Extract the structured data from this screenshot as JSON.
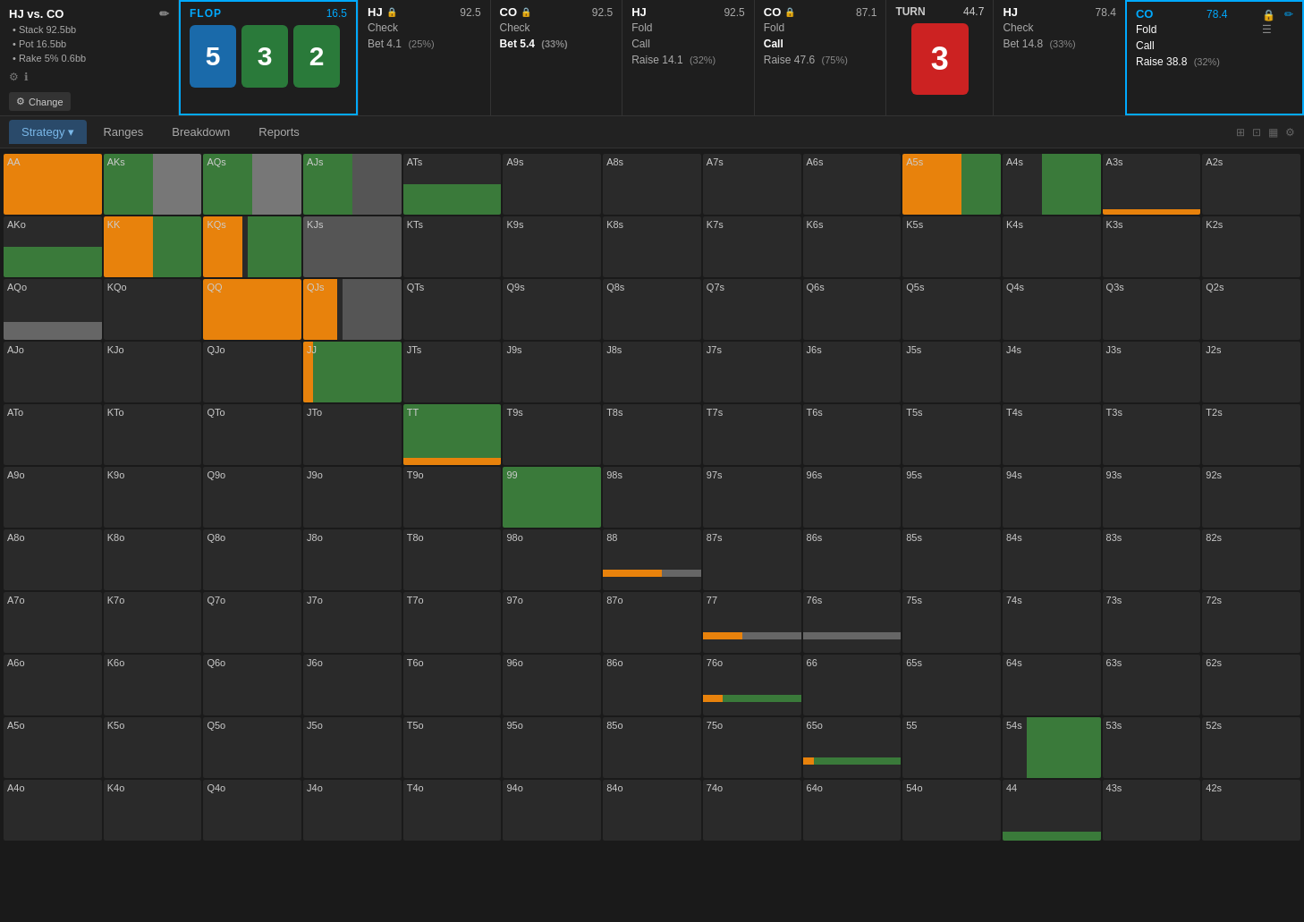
{
  "header": {
    "game_title": "HJ vs. CO",
    "stack": "Stack 92.5bb",
    "pot": "Pot 16.5bb",
    "rake": "Rake 5% 0.6bb",
    "change_btn": "Change",
    "flop": {
      "label": "FLOP",
      "pot": "16.5",
      "cards": [
        "5",
        "3",
        "2"
      ],
      "card_colors": [
        "blue",
        "green",
        "green"
      ]
    },
    "players": [
      {
        "name": "HJ",
        "stack": "92.5",
        "locked": true,
        "actions": [
          {
            "label": "Check",
            "pct": null,
            "active": false
          },
          {
            "label": "Bet 4.1",
            "pct": "(25%)",
            "active": false
          }
        ]
      },
      {
        "name": "CO",
        "stack": "92.5",
        "locked": true,
        "actions": [
          {
            "label": "Check",
            "pct": null,
            "active": false
          },
          {
            "label": "Bet 5.4",
            "pct": "(33%)",
            "active": true
          }
        ]
      },
      {
        "name": "HJ",
        "stack": "92.5",
        "locked": false,
        "actions": [
          {
            "label": "Fold",
            "pct": null,
            "active": false
          },
          {
            "label": "Call",
            "pct": null,
            "active": false
          },
          {
            "label": "Raise 14.1",
            "pct": "(32%)",
            "active": false
          }
        ]
      },
      {
        "name": "CO",
        "stack": "87.1",
        "locked": true,
        "actions": [
          {
            "label": "Fold",
            "pct": null,
            "active": false
          },
          {
            "label": "Call",
            "pct": null,
            "active": true
          },
          {
            "label": "Raise 47.6",
            "pct": "(75%)",
            "active": false
          }
        ]
      }
    ],
    "turn": {
      "label": "TURN",
      "pot": "44.7",
      "card": "3",
      "color": "red"
    },
    "players2": [
      {
        "name": "HJ",
        "stack": "78.4",
        "locked": false,
        "actions": [
          {
            "label": "Check",
            "pct": null,
            "active": false
          },
          {
            "label": "Bet 14.8",
            "pct": "(33%)",
            "active": false
          }
        ]
      },
      {
        "name": "CO",
        "stack": "78.4",
        "locked": false,
        "active_section": true,
        "actions": [
          {
            "label": "Fold",
            "pct": null,
            "active": false
          },
          {
            "label": "Call",
            "pct": null,
            "active": false
          },
          {
            "label": "Raise 38.8",
            "pct": "(32%)",
            "active": false
          }
        ]
      }
    ]
  },
  "nav": {
    "tabs": [
      "Strategy",
      "Ranges",
      "Breakdown",
      "Reports"
    ]
  },
  "grid": {
    "cells": [
      {
        "label": "AA",
        "type": "full-orange",
        "row": 0,
        "col": 0
      },
      {
        "label": "AKs",
        "type": "half-green-gray",
        "row": 0,
        "col": 1
      },
      {
        "label": "AQs",
        "type": "half-green-gray",
        "row": 0,
        "col": 2
      },
      {
        "label": "AJs",
        "type": "half-green-dark",
        "row": 0,
        "col": 3
      },
      {
        "label": "ATs",
        "type": "half-green-dark-top",
        "row": 0,
        "col": 4
      },
      {
        "label": "A9s",
        "type": "empty",
        "row": 0,
        "col": 5
      },
      {
        "label": "A8s",
        "type": "empty",
        "row": 0,
        "col": 6
      },
      {
        "label": "A7s",
        "type": "empty",
        "row": 0,
        "col": 7
      },
      {
        "label": "A6s",
        "type": "empty",
        "row": 0,
        "col": 8
      },
      {
        "label": "A5s",
        "type": "half-orange-green",
        "row": 0,
        "col": 9
      },
      {
        "label": "A4s",
        "type": "partial-green",
        "row": 0,
        "col": 10
      },
      {
        "label": "A3s",
        "type": "orange-line",
        "row": 0,
        "col": 11
      },
      {
        "label": "A2s",
        "type": "empty",
        "row": 0,
        "col": 12
      },
      {
        "label": "AKo",
        "type": "half-green-dark",
        "row": 1,
        "col": 0
      },
      {
        "label": "KK",
        "type": "full-orange-with-green",
        "row": 1,
        "col": 1
      },
      {
        "label": "KQs",
        "type": "half-orange-green-v2",
        "row": 1,
        "col": 2
      },
      {
        "label": "KJs",
        "type": "half-gray-dark",
        "row": 1,
        "col": 3
      },
      {
        "label": "KTs",
        "type": "empty",
        "row": 1,
        "col": 4
      },
      {
        "label": "K9s",
        "type": "empty",
        "row": 1,
        "col": 5
      },
      {
        "label": "K8s",
        "type": "empty",
        "row": 1,
        "col": 6
      },
      {
        "label": "K7s",
        "type": "empty",
        "row": 1,
        "col": 7
      },
      {
        "label": "K6s",
        "type": "empty",
        "row": 1,
        "col": 8
      },
      {
        "label": "K5s",
        "type": "empty",
        "row": 1,
        "col": 9
      },
      {
        "label": "K4s",
        "type": "empty",
        "row": 1,
        "col": 10
      },
      {
        "label": "K3s",
        "type": "empty",
        "row": 1,
        "col": 11
      },
      {
        "label": "K2s",
        "type": "empty",
        "row": 1,
        "col": 12
      },
      {
        "label": "AQo",
        "type": "small-gray",
        "row": 2,
        "col": 0
      },
      {
        "label": "KQo",
        "type": "empty",
        "row": 2,
        "col": 1
      },
      {
        "label": "QQ",
        "type": "full-orange",
        "row": 2,
        "col": 2
      },
      {
        "label": "QJs",
        "type": "half-orange-small-green",
        "row": 2,
        "col": 3
      },
      {
        "label": "QTs",
        "type": "empty",
        "row": 2,
        "col": 4
      },
      {
        "label": "Q9s",
        "type": "empty",
        "row": 2,
        "col": 5
      },
      {
        "label": "Q8s",
        "type": "empty",
        "row": 2,
        "col": 6
      },
      {
        "label": "Q7s",
        "type": "empty",
        "row": 2,
        "col": 7
      },
      {
        "label": "Q6s",
        "type": "empty",
        "row": 2,
        "col": 8
      },
      {
        "label": "Q5s",
        "type": "empty",
        "row": 2,
        "col": 9
      },
      {
        "label": "Q4s",
        "type": "empty",
        "row": 2,
        "col": 10
      },
      {
        "label": "Q3s",
        "type": "empty",
        "row": 2,
        "col": 11
      },
      {
        "label": "Q2s",
        "type": "empty",
        "row": 2,
        "col": 12
      },
      {
        "label": "AJo",
        "type": "empty",
        "row": 3,
        "col": 0
      },
      {
        "label": "KJo",
        "type": "empty",
        "row": 3,
        "col": 1
      },
      {
        "label": "QJo",
        "type": "empty",
        "row": 3,
        "col": 2
      },
      {
        "label": "JJ",
        "type": "full-green-small-orange",
        "row": 3,
        "col": 3
      },
      {
        "label": "JTs",
        "type": "empty",
        "row": 3,
        "col": 4
      },
      {
        "label": "J9s",
        "type": "empty",
        "row": 3,
        "col": 5
      },
      {
        "label": "J8s",
        "type": "empty",
        "row": 3,
        "col": 6
      },
      {
        "label": "J7s",
        "type": "empty",
        "row": 3,
        "col": 7
      },
      {
        "label": "J6s",
        "type": "empty",
        "row": 3,
        "col": 8
      },
      {
        "label": "J5s",
        "type": "empty",
        "row": 3,
        "col": 9
      },
      {
        "label": "J4s",
        "type": "empty",
        "row": 3,
        "col": 10
      },
      {
        "label": "J3s",
        "type": "empty",
        "row": 3,
        "col": 11
      },
      {
        "label": "J2s",
        "type": "empty",
        "row": 3,
        "col": 12
      },
      {
        "label": "ATo",
        "type": "empty",
        "row": 4,
        "col": 0
      },
      {
        "label": "KTo",
        "type": "empty",
        "row": 4,
        "col": 1
      },
      {
        "label": "QTo",
        "type": "empty",
        "row": 4,
        "col": 2
      },
      {
        "label": "JTo",
        "type": "empty",
        "row": 4,
        "col": 3
      },
      {
        "label": "TT",
        "type": "full-green-orange-line",
        "row": 4,
        "col": 4
      },
      {
        "label": "T9s",
        "type": "empty",
        "row": 4,
        "col": 5
      },
      {
        "label": "T8s",
        "type": "empty",
        "row": 4,
        "col": 6
      },
      {
        "label": "T7s",
        "type": "empty",
        "row": 4,
        "col": 7
      },
      {
        "label": "T6s",
        "type": "empty",
        "row": 4,
        "col": 8
      },
      {
        "label": "T5s",
        "type": "empty",
        "row": 4,
        "col": 9
      },
      {
        "label": "T4s",
        "type": "empty",
        "row": 4,
        "col": 10
      },
      {
        "label": "T3s",
        "type": "empty",
        "row": 4,
        "col": 11
      },
      {
        "label": "T2s",
        "type": "empty",
        "row": 4,
        "col": 12
      },
      {
        "label": "A9o",
        "type": "empty",
        "row": 5,
        "col": 0
      },
      {
        "label": "K9o",
        "type": "empty",
        "row": 5,
        "col": 1
      },
      {
        "label": "Q9o",
        "type": "empty",
        "row": 5,
        "col": 2
      },
      {
        "label": "J9o",
        "type": "empty",
        "row": 5,
        "col": 3
      },
      {
        "label": "T9o",
        "type": "empty",
        "row": 5,
        "col": 4
      },
      {
        "label": "99",
        "type": "full-green",
        "row": 5,
        "col": 5
      },
      {
        "label": "98s",
        "type": "empty",
        "row": 5,
        "col": 6
      },
      {
        "label": "97s",
        "type": "empty",
        "row": 5,
        "col": 7
      },
      {
        "label": "96s",
        "type": "empty",
        "row": 5,
        "col": 8
      },
      {
        "label": "95s",
        "type": "empty",
        "row": 5,
        "col": 9
      },
      {
        "label": "94s",
        "type": "empty",
        "row": 5,
        "col": 10
      },
      {
        "label": "93s",
        "type": "empty",
        "row": 5,
        "col": 11
      },
      {
        "label": "92s",
        "type": "empty",
        "row": 5,
        "col": 12
      },
      {
        "label": "A8o",
        "type": "empty",
        "row": 6,
        "col": 0
      },
      {
        "label": "K8o",
        "type": "empty",
        "row": 6,
        "col": 1
      },
      {
        "label": "Q8o",
        "type": "empty",
        "row": 6,
        "col": 2
      },
      {
        "label": "J8o",
        "type": "empty",
        "row": 6,
        "col": 3
      },
      {
        "label": "T8o",
        "type": "empty",
        "row": 6,
        "col": 4
      },
      {
        "label": "98o",
        "type": "empty",
        "row": 6,
        "col": 5
      },
      {
        "label": "88",
        "type": "bar-orange-gray",
        "row": 6,
        "col": 6
      },
      {
        "label": "87s",
        "type": "empty",
        "row": 6,
        "col": 7
      },
      {
        "label": "86s",
        "type": "empty",
        "row": 6,
        "col": 8
      },
      {
        "label": "85s",
        "type": "empty",
        "row": 6,
        "col": 9
      },
      {
        "label": "84s",
        "type": "empty",
        "row": 6,
        "col": 10
      },
      {
        "label": "83s",
        "type": "empty",
        "row": 6,
        "col": 11
      },
      {
        "label": "82s",
        "type": "empty",
        "row": 6,
        "col": 12
      },
      {
        "label": "A7o",
        "type": "empty",
        "row": 7,
        "col": 0
      },
      {
        "label": "K7o",
        "type": "empty",
        "row": 7,
        "col": 1
      },
      {
        "label": "Q7o",
        "type": "empty",
        "row": 7,
        "col": 2
      },
      {
        "label": "J7o",
        "type": "empty",
        "row": 7,
        "col": 3
      },
      {
        "label": "T7o",
        "type": "empty",
        "row": 7,
        "col": 4
      },
      {
        "label": "97o",
        "type": "empty",
        "row": 7,
        "col": 5
      },
      {
        "label": "87o",
        "type": "empty",
        "row": 7,
        "col": 6
      },
      {
        "label": "77",
        "type": "bar-orange-gray2",
        "row": 7,
        "col": 7
      },
      {
        "label": "76s",
        "type": "bar-gray",
        "row": 7,
        "col": 8
      },
      {
        "label": "75s",
        "type": "empty",
        "row": 7,
        "col": 9
      },
      {
        "label": "74s",
        "type": "empty",
        "row": 7,
        "col": 10
      },
      {
        "label": "73s",
        "type": "empty",
        "row": 7,
        "col": 11
      },
      {
        "label": "72s",
        "type": "empty",
        "row": 7,
        "col": 12
      },
      {
        "label": "A6o",
        "type": "empty",
        "row": 8,
        "col": 0
      },
      {
        "label": "K6o",
        "type": "empty",
        "row": 8,
        "col": 1
      },
      {
        "label": "Q6o",
        "type": "empty",
        "row": 8,
        "col": 2
      },
      {
        "label": "J6o",
        "type": "empty",
        "row": 8,
        "col": 3
      },
      {
        "label": "T6o",
        "type": "empty",
        "row": 8,
        "col": 4
      },
      {
        "label": "96o",
        "type": "empty",
        "row": 8,
        "col": 5
      },
      {
        "label": "86o",
        "type": "empty",
        "row": 8,
        "col": 6
      },
      {
        "label": "76o",
        "type": "bar-orange-green3",
        "row": 8,
        "col": 7
      },
      {
        "label": "66",
        "type": "empty",
        "row": 8,
        "col": 8
      },
      {
        "label": "65s",
        "type": "empty",
        "row": 8,
        "col": 9
      },
      {
        "label": "64s",
        "type": "empty",
        "row": 8,
        "col": 10
      },
      {
        "label": "63s",
        "type": "empty",
        "row": 8,
        "col": 11
      },
      {
        "label": "62s",
        "type": "empty",
        "row": 8,
        "col": 12
      },
      {
        "label": "A5o",
        "type": "empty",
        "row": 9,
        "col": 0
      },
      {
        "label": "K5o",
        "type": "empty",
        "row": 9,
        "col": 1
      },
      {
        "label": "Q5o",
        "type": "empty",
        "row": 9,
        "col": 2
      },
      {
        "label": "J5o",
        "type": "empty",
        "row": 9,
        "col": 3
      },
      {
        "label": "T5o",
        "type": "empty",
        "row": 9,
        "col": 4
      },
      {
        "label": "95o",
        "type": "empty",
        "row": 9,
        "col": 5
      },
      {
        "label": "85o",
        "type": "empty",
        "row": 9,
        "col": 6
      },
      {
        "label": "75o",
        "type": "empty",
        "row": 9,
        "col": 7
      },
      {
        "label": "65o",
        "type": "bar-orange-green4",
        "row": 9,
        "col": 8
      },
      {
        "label": "55",
        "type": "empty",
        "row": 9,
        "col": 9
      },
      {
        "label": "54s",
        "type": "partial-green2",
        "row": 9,
        "col": 10
      },
      {
        "label": "53s",
        "type": "empty",
        "row": 9,
        "col": 11
      },
      {
        "label": "52s",
        "type": "empty",
        "row": 9,
        "col": 12
      },
      {
        "label": "A4o",
        "type": "empty",
        "row": 10,
        "col": 0
      },
      {
        "label": "K4o",
        "type": "empty",
        "row": 10,
        "col": 1
      },
      {
        "label": "Q4o",
        "type": "empty",
        "row": 10,
        "col": 2
      },
      {
        "label": "J4o",
        "type": "empty",
        "row": 10,
        "col": 3
      },
      {
        "label": "T4o",
        "type": "empty",
        "row": 10,
        "col": 4
      },
      {
        "label": "94o",
        "type": "empty",
        "row": 10,
        "col": 5
      },
      {
        "label": "84o",
        "type": "empty",
        "row": 10,
        "col": 6
      },
      {
        "label": "74o",
        "type": "empty",
        "row": 10,
        "col": 7
      },
      {
        "label": "64o",
        "type": "empty",
        "row": 10,
        "col": 8
      },
      {
        "label": "54o",
        "type": "empty",
        "row": 10,
        "col": 9
      },
      {
        "label": "44",
        "type": "partial-green3",
        "row": 10,
        "col": 10
      },
      {
        "label": "43s",
        "type": "empty",
        "row": 10,
        "col": 11
      },
      {
        "label": "42s",
        "type": "empty",
        "row": 10,
        "col": 12
      }
    ]
  }
}
